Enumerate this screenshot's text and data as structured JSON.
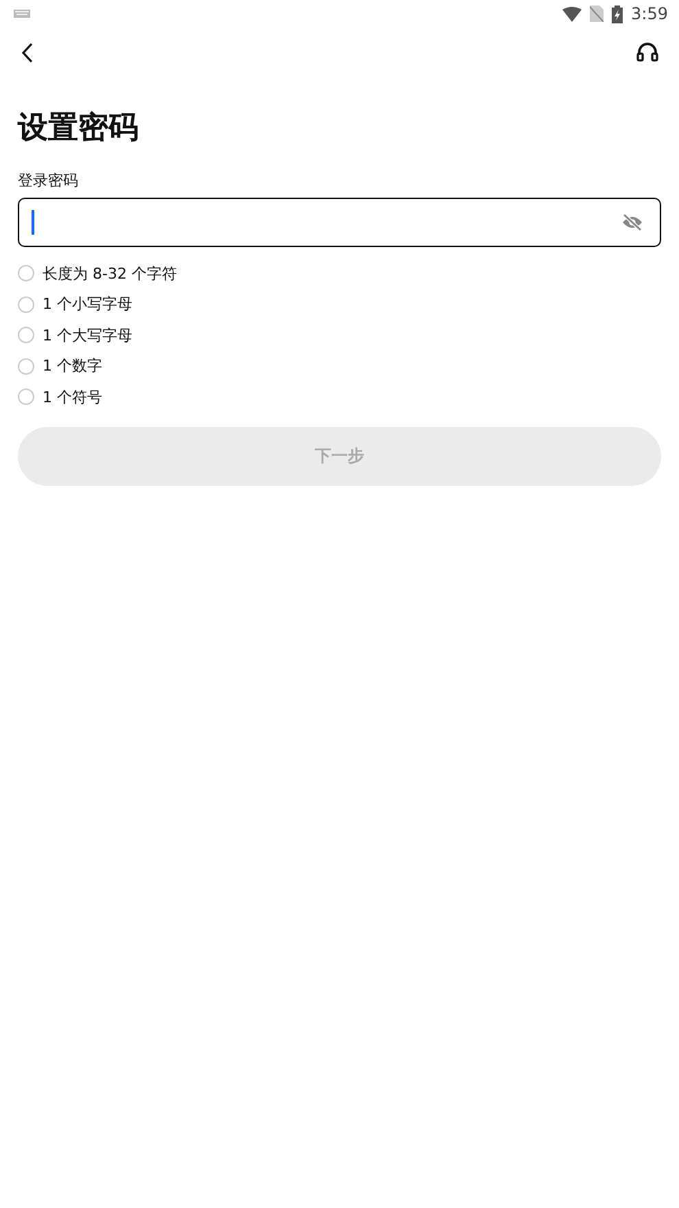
{
  "status_bar": {
    "time": "3:59"
  },
  "title": "设置密码",
  "password_field": {
    "label": "登录密码",
    "focused": true,
    "password_visible": false
  },
  "requirements": [
    {
      "text": "长度为 8-32 个字符",
      "met": false
    },
    {
      "text": "1 个小写字母",
      "met": false
    },
    {
      "text": "1 个大写字母",
      "met": false
    },
    {
      "text": "1 个数字",
      "met": false
    },
    {
      "text": "1 个符号",
      "met": false
    }
  ],
  "next_button": {
    "label": "下一步",
    "disabled": true
  }
}
